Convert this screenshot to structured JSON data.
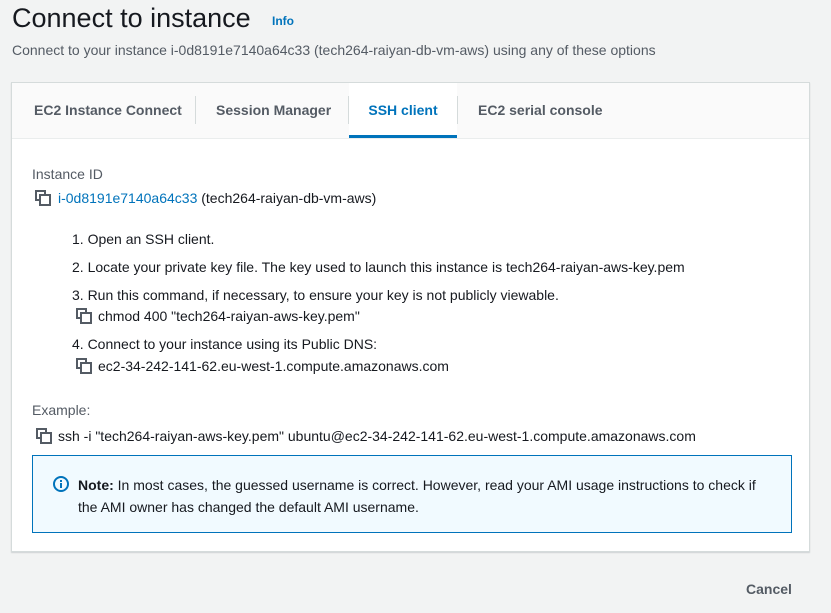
{
  "header": {
    "title": "Connect to instance",
    "info_label": "Info",
    "subtitle": "Connect to your instance i-0d8191e7140a64c33 (tech264-raiyan-db-vm-aws) using any of these options"
  },
  "tabs": [
    {
      "label": "EC2 Instance Connect",
      "active": false
    },
    {
      "label": "Session Manager",
      "active": false
    },
    {
      "label": "SSH client",
      "active": true
    },
    {
      "label": "EC2 serial console",
      "active": false
    }
  ],
  "instance": {
    "label": "Instance ID",
    "id": "i-0d8191e7140a64c33",
    "name": "(tech264-raiyan-db-vm-aws)"
  },
  "steps": [
    "1. Open an SSH client.",
    "2. Locate your private key file. The key used to launch this instance is tech264-raiyan-aws-key.pem",
    "3. Run this command, if necessary, to ensure your key is not publicly viewable.",
    "4. Connect to your instance using its Public DNS:"
  ],
  "commands": {
    "chmod": "chmod 400 \"tech264-raiyan-aws-key.pem\"",
    "public_dns": "ec2-34-242-141-62.eu-west-1.compute.amazonaws.com"
  },
  "example": {
    "label": "Example:",
    "command": "ssh -i \"tech264-raiyan-aws-key.pem\" ubuntu@ec2-34-242-141-62.eu-west-1.compute.amazonaws.com"
  },
  "note": {
    "title": "Note:",
    "body": " In most cases, the guessed username is correct. However, read your AMI usage instructions to check if the AMI owner has changed the default AMI username."
  },
  "footer": {
    "cancel_label": "Cancel"
  },
  "colors": {
    "accent": "#0073bb",
    "background": "#f2f3f3"
  }
}
